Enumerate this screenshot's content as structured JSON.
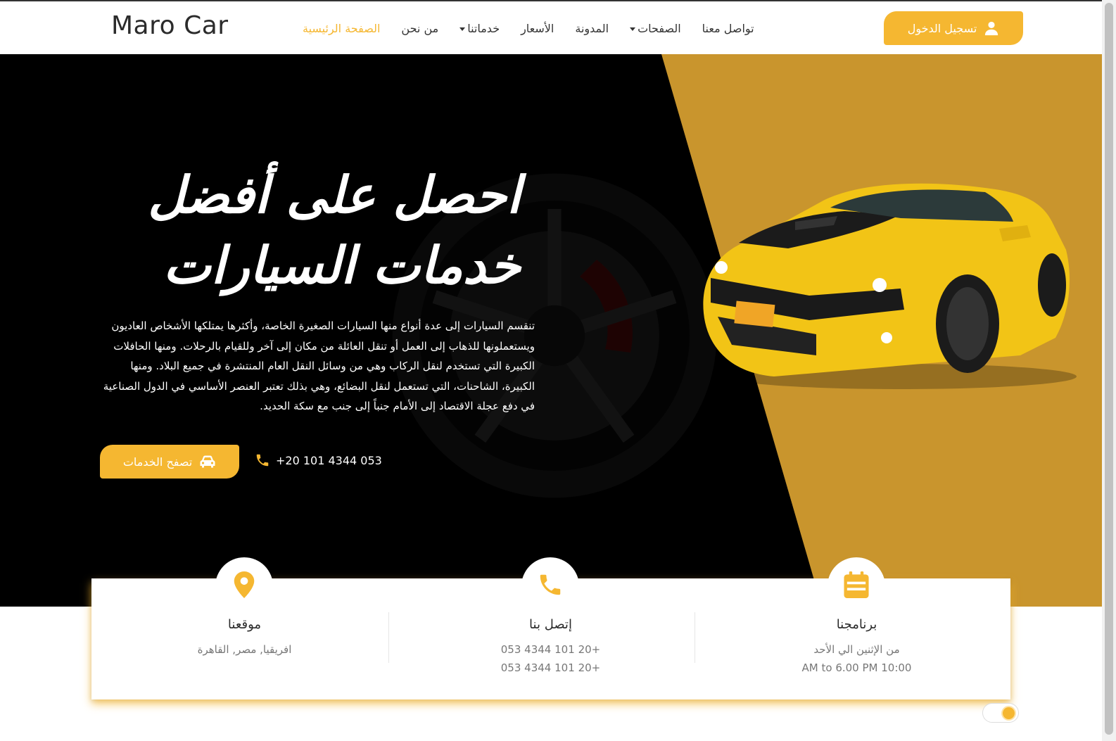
{
  "brand": "Maro Car",
  "nav": {
    "items": [
      {
        "label": "الصفحة الرئيسية",
        "active": true,
        "dropdown": false
      },
      {
        "label": "من نحن",
        "active": false,
        "dropdown": false
      },
      {
        "label": "خدماتنا",
        "active": false,
        "dropdown": true
      },
      {
        "label": "الأسعار",
        "active": false,
        "dropdown": false
      },
      {
        "label": "المدونة",
        "active": false,
        "dropdown": false
      },
      {
        "label": "الصفحات",
        "active": false,
        "dropdown": true
      },
      {
        "label": "تواصل معنا",
        "active": false,
        "dropdown": false
      }
    ],
    "login_label": "تسجيل الدخول"
  },
  "hero": {
    "title_line1": "احصل على أفضل",
    "title_line2": "خدمات السيارات",
    "paragraph": "تنقسم السيارات إلى عدة أنواع منها السيارات الصغيرة الخاصة، وأكثرها يمتلكها الأشخاص العاديون ويستعملونها للذهاب إلى العمل أو تنقل العائلة من مكان إلى آخر وللقيام بالرحلات. ومنها الحافلات الكبيرة التي تستخدم لنقل الركاب وهي من وسائل النقل العام المنتشرة في جميع البلاد. ومنها الكبيرة، الشاحنات، التي تستعمل لنقل البضائع، وهي بذلك تعتبر العنصر الأساسي في الدول الصناعية في دفع عجلة الاقتصاد إلى الأمام جنباً إلى جنب مع سكة الحديد.",
    "services_button": "تصفح الخدمات",
    "phone": "+20 101 4344 053"
  },
  "info": {
    "schedule": {
      "title": "برنامجنا",
      "line1": "من الإثنين الي الأحد",
      "line2": "10:00 AM to 6.00 PM",
      "icon": "calendar-icon"
    },
    "contact": {
      "title": "إتصل بنا",
      "line1": "+20 101 4344 053",
      "line2": "+20 101 4344 053",
      "icon": "phone-icon"
    },
    "location": {
      "title": "موقعنا",
      "line1": "افريقيا, مصر, القاهرة",
      "icon": "map-pin-icon"
    }
  },
  "colors": {
    "accent": "#f5b731",
    "hero_bg": "#000000",
    "hero_panel": "#c9952d"
  }
}
